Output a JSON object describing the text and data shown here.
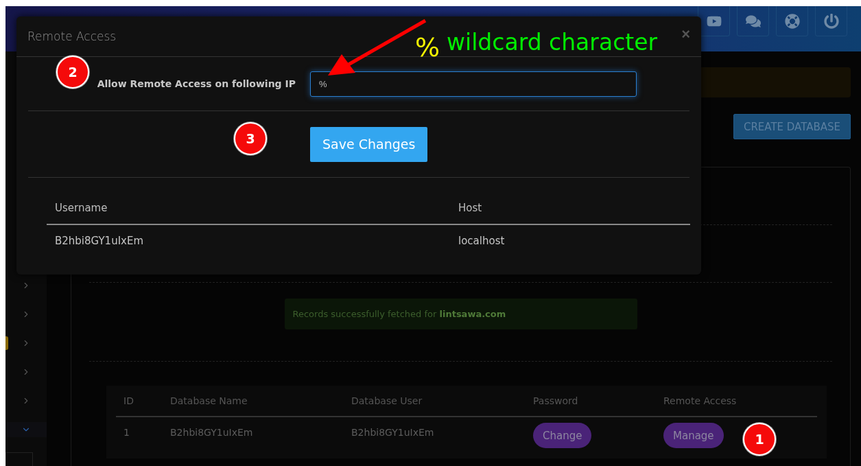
{
  "sidebar": {
    "items": [
      {
        "expanded": false
      },
      {
        "expanded": false
      },
      {
        "expanded": false
      },
      {
        "expanded": false
      },
      {
        "expanded": false
      },
      {
        "expanded": true
      }
    ]
  },
  "page": {
    "create_button": "CREATE DATABASE",
    "notice": "Records successfully fetched for **lintsawa.com**",
    "table": {
      "columns": [
        "ID",
        "Database Name",
        "Database User",
        "Password",
        "Remote Access"
      ],
      "rows": [
        {
          "id": "1",
          "name": "B2hbi8GY1uIxEm",
          "user": "B2hbi8GY1uIxEm",
          "password_action": "Change",
          "remote_action": "Manage"
        }
      ]
    }
  },
  "modal": {
    "title": "Remote Access",
    "close": "×",
    "ip_label": "Allow Remote Access on following IP",
    "ip_value": "%",
    "save_button": "Save Changes",
    "table": {
      "columns": [
        "Username",
        "Host"
      ],
      "rows": [
        [
          "B2hbi8GY1uIxEm",
          "localhost"
        ]
      ]
    }
  },
  "annotations": {
    "badges": [
      "2",
      "3",
      "1"
    ],
    "callout": {
      "symbol": "%",
      "text": "wildcard character"
    }
  }
}
